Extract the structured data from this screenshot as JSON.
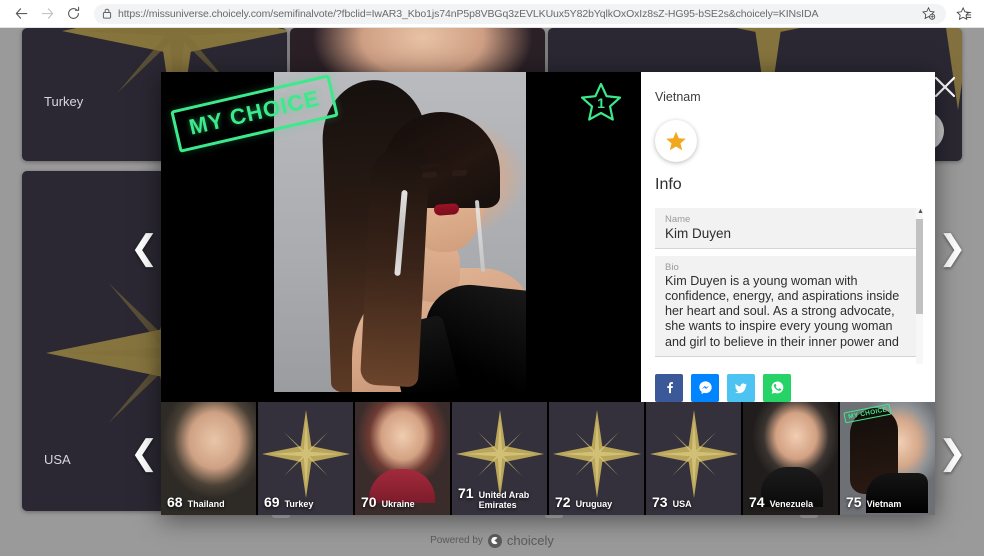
{
  "browser": {
    "back_icon": "arrow-left-icon",
    "forward_icon": "arrow-right-icon",
    "reload_icon": "reload-icon",
    "lock_icon": "lock-icon",
    "url_host": "https://missuniverse.choicely.com",
    "url_path": "/semifinalvote/?fbclid=IwAR3_Kbo1js74nP5p8VBGq3zEVLKUux5Y82bYqlkOxOxIz8sZ-HG95-bSE2s&choicely=KINsIDA",
    "url_full": "https://missuniverse.choicely.com/semifinalvote/?fbclid=IwAR3_Kbo1js74nP5p8VBGq3zEVLKUux5Y82bYqlkOxOxIz8sZ-HG95-bSE2s&choicely=KINsIDA",
    "add_favorite_icon": "star-plus-icon",
    "favorites_list_icon": "star-list-icon"
  },
  "background_cards": [
    {
      "name": "Turkey",
      "kind": "star"
    },
    {
      "name": "USA",
      "kind": "star"
    },
    {
      "name": "",
      "kind": "photo"
    },
    {
      "name": "",
      "kind": "star"
    }
  ],
  "modal": {
    "close_icon": "close-icon",
    "prev_icon": "chevron-left-icon",
    "next_icon": "chevron-right-icon",
    "stamp_label": "MY CHOICE",
    "rank_badge": "1",
    "rank_badge_icon": "star-outline-icon",
    "info": {
      "country": "Vietnam",
      "favorite_icon": "star-filled-icon",
      "title": "Info",
      "fields": [
        {
          "label": "Name",
          "value": "Kim Duyen"
        },
        {
          "label": "Bio",
          "value": "Kim Duyen is a young woman with confidence, energy, and aspirations inside her heart and soul. As a strong advocate, she wants to inspire every young woman and girl to believe in their inner power and"
        }
      ],
      "scroll_up_icon": "caret-up-icon",
      "scroll_down_icon": "caret-down-icon",
      "share_buttons": [
        {
          "name": "facebook-share-button",
          "glyph": "f",
          "color": "#3b5998"
        },
        {
          "name": "messenger-share-button",
          "glyph": "●",
          "color": "#0084ff"
        },
        {
          "name": "twitter-share-button",
          "glyph": "●",
          "color": "#4cc3f0"
        },
        {
          "name": "whatsapp-share-button",
          "glyph": "●",
          "color": "#25d366"
        }
      ]
    }
  },
  "thumbnails": [
    {
      "number": "68",
      "name": "Thailand",
      "kind": "photo",
      "selected": false,
      "stamp": ""
    },
    {
      "number": "69",
      "name": "Turkey",
      "kind": "star",
      "selected": false,
      "stamp": ""
    },
    {
      "number": "70",
      "name": "Ukraine",
      "kind": "photo",
      "selected": false,
      "stamp": ""
    },
    {
      "number": "71",
      "name": "United Arab Emirates",
      "kind": "star",
      "selected": false,
      "stamp": ""
    },
    {
      "number": "72",
      "name": "Uruguay",
      "kind": "star",
      "selected": false,
      "stamp": ""
    },
    {
      "number": "73",
      "name": "USA",
      "kind": "star",
      "selected": false,
      "stamp": ""
    },
    {
      "number": "74",
      "name": "Venezuela",
      "kind": "photo",
      "selected": false,
      "stamp": ""
    },
    {
      "number": "75",
      "name": "Vietnam",
      "kind": "photo",
      "selected": true,
      "stamp": "MY CHOICE"
    }
  ],
  "footer": {
    "powered_by": "Powered by",
    "brand": "choicely",
    "logo_icon": "choicely-logo-icon"
  },
  "colors": {
    "accent_green": "#3ce98b",
    "card_bg": "#2b2833",
    "page_bg": "#9a9a9a",
    "star_gold": "#9c8741"
  }
}
